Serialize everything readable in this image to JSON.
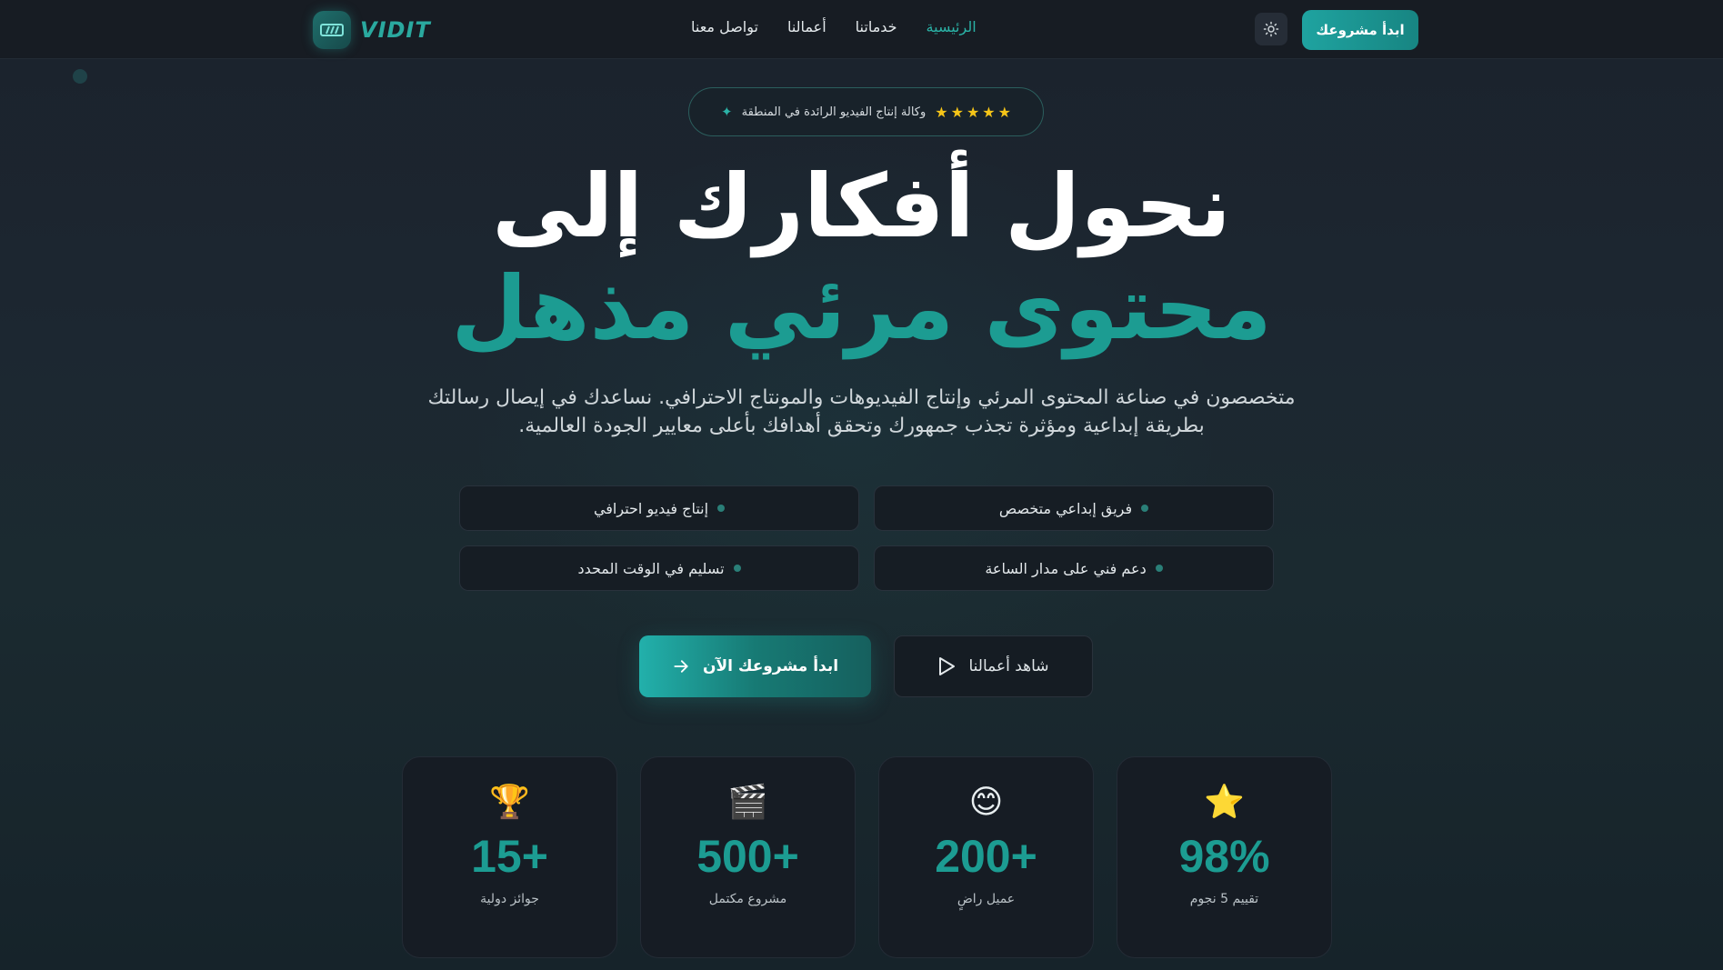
{
  "brand": {
    "logo_text": "VIDIT"
  },
  "nav": {
    "links": [
      {
        "label": "الرئيسية",
        "active": true
      },
      {
        "label": "خدماتنا",
        "active": false
      },
      {
        "label": "أعمالنا",
        "active": false
      },
      {
        "label": "تواصل معنا",
        "active": false
      }
    ],
    "theme_toggle_icon": "sun-icon",
    "cta_label": "ابدأ مشروعك"
  },
  "hero": {
    "badge": {
      "stars": 5,
      "text": "وكالة إنتاج الفيديو الرائدة في المنطقة",
      "icon": "sparkle-icon"
    },
    "headline_line1": "نحول أفكارك إلى",
    "headline_line2": "محتوى مرئي مذهل",
    "subtitle": "متخصصون في صناعة المحتوى المرئي وإنتاج الفيديوهات والمونتاج الاحترافي. نساعدك في إيصال رسالتك بطريقة إبداعية ومؤثرة تجذب جمهورك وتحقق أهدافك بأعلى معايير الجودة العالمية.",
    "features": [
      "فريق إبداعي متخصص",
      "إنتاج فيديو احترافي",
      "دعم فني على مدار الساعة",
      "تسليم في الوقت المحدد"
    ],
    "primary_cta": "ابدأ مشروعك الآن",
    "secondary_cta": "شاهد أعمالنا"
  },
  "stats": [
    {
      "emoji": "⭐",
      "value": "98%",
      "label": "تقييم 5 نجوم"
    },
    {
      "emoji": "😊",
      "value": "200+",
      "label": "عميل راضٍ"
    },
    {
      "emoji": "🎬",
      "value": "500+",
      "label": "مشروع مكتمل"
    },
    {
      "emoji": "🏆",
      "value": "15+",
      "label": "جوائز دولية"
    }
  ],
  "colors": {
    "accent": "#1c9c92",
    "accent_light": "#2bb3a7",
    "background": "#1c2731",
    "star": "#f5c518"
  }
}
